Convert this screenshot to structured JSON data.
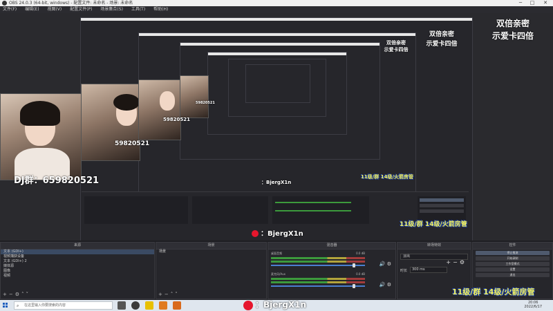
{
  "window": {
    "title": "OBS 24.0.3 (64-bit, windows) - 配置文件: 未命名 - 场景: 未命名",
    "minimize": "─",
    "maximize": "□",
    "close": "✕"
  },
  "menu": [
    "文件(F)",
    "编辑(E)",
    "视图(V)",
    "配置文件(P)",
    "场景集合(S)",
    "工具(T)",
    "帮助(H)"
  ],
  "overlay": {
    "promo_line1": "双倍亲密",
    "promo_line2": "示爱卡四倍",
    "cam_id": "59820521",
    "dj_group": "DJ群：659820521",
    "weibo": "：BjergX1n",
    "room_tag": "11级/群 14级/火箭房管"
  },
  "docks": {
    "scenes_header": "来源",
    "sources_list": [
      "文本 (GDI+)",
      "视频捕获设备",
      "文本 (GDI+) 2",
      "媒体源",
      "图像",
      "视频"
    ],
    "scene_header": "场景",
    "scene_list": [
      "场景"
    ],
    "mixer_header": "混音器",
    "mixer": [
      {
        "name": "桌面音频",
        "db": "0.0 dB"
      },
      {
        "name": "麦克风/Aux",
        "db": "0.0 dB"
      }
    ],
    "transitions_header": "转场特效",
    "transition_type": "淡出",
    "duration_label": "时长",
    "duration_value": "300 ms",
    "controls_header": "控件",
    "controls": [
      "停止推流",
      "开始录制",
      "工作室模式",
      "设置",
      "退出"
    ]
  },
  "taskbar": {
    "search_placeholder": "在这里输入你要搜索的内容",
    "time": "20:06",
    "date": "2022/6/17"
  }
}
